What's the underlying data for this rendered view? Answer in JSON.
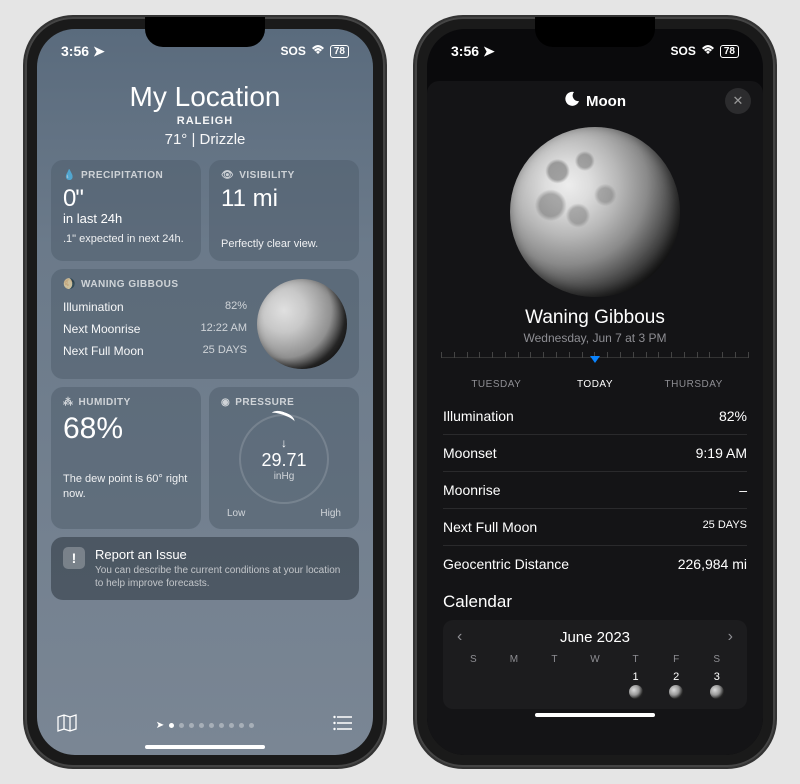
{
  "status": {
    "time": "3:56",
    "sos": "SOS",
    "battery": "78"
  },
  "weather": {
    "location_title": "My Location",
    "city": "RALEIGH",
    "temp_cond": "71°  |  Drizzle",
    "precip": {
      "header": "PRECIPITATION",
      "value": "0\"",
      "period": "in last 24h",
      "desc": ".1\" expected in next 24h."
    },
    "visibility": {
      "header": "VISIBILITY",
      "value": "11 mi",
      "desc": "Perfectly clear view."
    },
    "moon": {
      "header": "WANING GIBBOUS",
      "illumination_label": "Illumination",
      "illumination_value": "82%",
      "moonrise_label": "Next Moonrise",
      "moonrise_value": "12:22 AM",
      "fullmoon_label": "Next Full Moon",
      "fullmoon_value": "25 DAYS"
    },
    "humidity": {
      "header": "HUMIDITY",
      "value": "68%",
      "desc": "The dew point is 60° right now."
    },
    "pressure": {
      "header": "PRESSURE",
      "value": "29.71",
      "unit": "inHg",
      "low": "Low",
      "high": "High"
    },
    "report": {
      "title": "Report an Issue",
      "desc": "You can describe the current conditions at your location to help improve forecasts."
    }
  },
  "moon_detail": {
    "title": "Moon",
    "phase": "Waning Gibbous",
    "date": "Wednesday, Jun 7 at 3 PM",
    "timeline": {
      "prev": "TUESDAY",
      "cur": "TODAY",
      "next": "THURSDAY"
    },
    "rows": {
      "illumination": {
        "label": "Illumination",
        "value": "82%"
      },
      "moonset": {
        "label": "Moonset",
        "value": "9:19 AM"
      },
      "moonrise": {
        "label": "Moonrise",
        "value": "–"
      },
      "fullmoon": {
        "label": "Next Full Moon",
        "value": "25 DAYS"
      },
      "distance": {
        "label": "Geocentric Distance",
        "value": "226,984 mi"
      }
    },
    "calendar": {
      "section_title": "Calendar",
      "month": "June 2023",
      "dow": [
        "S",
        "M",
        "T",
        "W",
        "T",
        "F",
        "S"
      ],
      "days": [
        "",
        "",
        "",
        "",
        "1",
        "2",
        "3"
      ]
    }
  }
}
